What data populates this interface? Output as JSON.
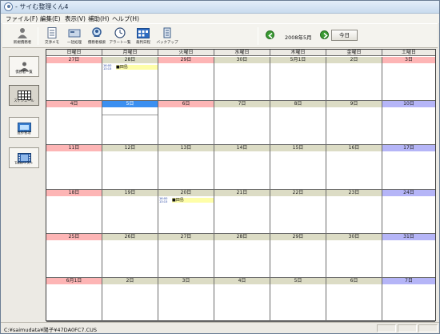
{
  "window": {
    "title": "- サイむ整理くん4"
  },
  "menu": [
    {
      "label": "ファイル(F)"
    },
    {
      "label": "編集(E)"
    },
    {
      "label": "表示(V)"
    },
    {
      "label": "補助(H)"
    },
    {
      "label": "ヘルプ(H)"
    }
  ],
  "toolbar": [
    {
      "label": "新規債務者",
      "icon": "person-icon"
    },
    {
      "label": "交渉メモ",
      "icon": "memo-icon"
    },
    {
      "label": "一括処理",
      "icon": "batch-icon"
    },
    {
      "label": "債務者検索",
      "icon": "search-icon"
    },
    {
      "label": "アラート一覧",
      "icon": "clock-icon"
    },
    {
      "label": "裁判日程",
      "icon": "calendar-bars-icon"
    },
    {
      "label": "バックアップ",
      "icon": "backup-icon"
    }
  ],
  "nav": {
    "month": "2008年5月",
    "today": "今日"
  },
  "side": [
    {
      "label": "債務者一覧",
      "icon": "person-list-icon"
    },
    {
      "label": "スケジュール",
      "icon": "schedule-icon"
    },
    {
      "label": "進捗管理",
      "icon": "progress-icon"
    },
    {
      "label": "ToDoリスト",
      "icon": "film-list-icon"
    }
  ],
  "days": [
    "日曜日",
    "月曜日",
    "火曜日",
    "水曜日",
    "木曜日",
    "金曜日",
    "土曜日"
  ],
  "colors": {
    "sunday": "#fdb5b5",
    "weekday": "#dcdcc5",
    "saturday": "#b5b5f7",
    "selected": "#3b8ff0"
  },
  "weeks": [
    [
      {
        "label": "27日",
        "kind": "sunday"
      },
      {
        "label": "28日",
        "kind": "weekday",
        "event": {
          "time": "16:00\n13:15",
          "name": "■田島"
        }
      },
      {
        "label": "29日",
        "kind": "sunday"
      },
      {
        "label": "30日",
        "kind": "weekday"
      },
      {
        "label": "5月1日",
        "kind": "weekday"
      },
      {
        "label": "2日",
        "kind": "weekday"
      },
      {
        "label": "3日",
        "kind": "sunday"
      }
    ],
    [
      {
        "label": "4日",
        "kind": "sunday"
      },
      {
        "label": "5日",
        "kind": "selected"
      },
      {
        "label": "6日",
        "kind": "sunday"
      },
      {
        "label": "7日",
        "kind": "weekday"
      },
      {
        "label": "8日",
        "kind": "weekday"
      },
      {
        "label": "9日",
        "kind": "weekday"
      },
      {
        "label": "10日",
        "kind": "saturday"
      }
    ],
    [
      {
        "label": "11日",
        "kind": "sunday"
      },
      {
        "label": "12日",
        "kind": "weekday"
      },
      {
        "label": "13日",
        "kind": "weekday"
      },
      {
        "label": "14日",
        "kind": "weekday"
      },
      {
        "label": "15日",
        "kind": "weekday"
      },
      {
        "label": "16日",
        "kind": "weekday"
      },
      {
        "label": "17日",
        "kind": "saturday"
      }
    ],
    [
      {
        "label": "18日",
        "kind": "sunday"
      },
      {
        "label": "19日",
        "kind": "weekday"
      },
      {
        "label": "20日",
        "kind": "weekday",
        "event": {
          "time": "16:00\n13:15",
          "name": "■田島"
        }
      },
      {
        "label": "21日",
        "kind": "weekday"
      },
      {
        "label": "22日",
        "kind": "weekday"
      },
      {
        "label": "23日",
        "kind": "weekday"
      },
      {
        "label": "24日",
        "kind": "saturday"
      }
    ],
    [
      {
        "label": "25日",
        "kind": "sunday"
      },
      {
        "label": "26日",
        "kind": "weekday"
      },
      {
        "label": "27日",
        "kind": "weekday"
      },
      {
        "label": "28日",
        "kind": "weekday"
      },
      {
        "label": "29日",
        "kind": "weekday"
      },
      {
        "label": "30日",
        "kind": "weekday"
      },
      {
        "label": "31日",
        "kind": "saturday"
      }
    ],
    [
      {
        "label": "6月1日",
        "kind": "sunday"
      },
      {
        "label": "2日",
        "kind": "weekday"
      },
      {
        "label": "3日",
        "kind": "weekday"
      },
      {
        "label": "4日",
        "kind": "weekday"
      },
      {
        "label": "5日",
        "kind": "weekday"
      },
      {
        "label": "6日",
        "kind": "weekday"
      },
      {
        "label": "7日",
        "kind": "saturday"
      }
    ]
  ],
  "status": {
    "path": "C:¥saimudata¥陽子¥47DA0FC7.CUS"
  }
}
